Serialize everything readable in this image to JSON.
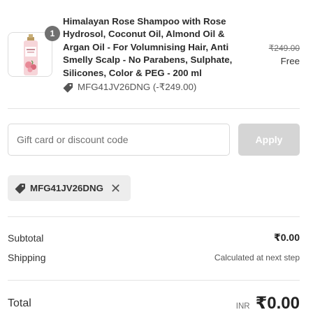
{
  "product": {
    "quantity": "1",
    "name": "Himalayan Rose Shampoo with Rose Hydrosol, Coconut Oil, Almond Oil & Argan Oil - For Volumnising Hair, Anti Smelly Scalp - No Parabens, Sulphate, Silicones, Color & PEG - 200 ml",
    "discount_text": "MFG41JV26DNG (-₹249.00)",
    "original_price": "₹249.00",
    "price": "Free",
    "thumb_icon": "shampoo-bottle"
  },
  "discount_form": {
    "placeholder": "Gift card or discount code",
    "value": "",
    "apply_label": "Apply"
  },
  "applied_code": {
    "code": "MFG41JV26DNG",
    "remove_icon": "close-icon"
  },
  "summary": {
    "subtotal_label": "Subtotal",
    "subtotal_value": "₹0.00",
    "shipping_label": "Shipping",
    "shipping_value": "Calculated at next step",
    "total_label": "Total",
    "currency": "INR",
    "total_value": "₹0.00"
  },
  "colors": {
    "apply_disabled_bg": "#d5d5d5",
    "chip_bg": "#ededed",
    "badge_bg": "#707070"
  }
}
